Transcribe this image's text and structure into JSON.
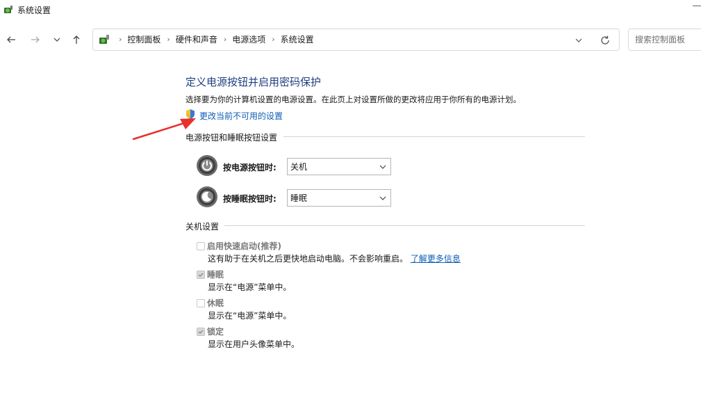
{
  "window": {
    "title": "系统设置",
    "app_icon": "power-options-icon"
  },
  "nav": {
    "back_icon": "back-arrow-icon",
    "forward_icon": "forward-arrow-icon",
    "recent_icon": "chevron-down-icon",
    "up_icon": "up-arrow-icon",
    "breadcrumbs": [
      "控制面板",
      "硬件和声音",
      "电源选项",
      "系统设置"
    ],
    "search_placeholder": "搜索控制面板"
  },
  "main": {
    "title": "定义电源按钮并启用密码保护",
    "description": "选择要为你的计算机设置的电源设置。在此页上对设置所做的更改将应用于你所有的电源计划。",
    "change_link": "更改当前不可用的设置",
    "power_section": {
      "label": "电源按钮和睡眠按钮设置",
      "rows": [
        {
          "label": "按电源按钮时:",
          "value": "关机"
        },
        {
          "label": "按睡眠按钮时:",
          "value": "睡眠"
        }
      ]
    },
    "shutdown_section": {
      "label": "关机设置",
      "options": [
        {
          "label": "启用快速启动(推荐)",
          "checked": false,
          "desc": "这有助于在关机之后更快地启动电脑。不会影响重启。",
          "link": "了解更多信息"
        },
        {
          "label": "睡眠",
          "checked": true,
          "desc": "显示在“电源”菜单中。"
        },
        {
          "label": "休眠",
          "checked": false,
          "desc": "显示在“电源”菜单中。"
        },
        {
          "label": "锁定",
          "checked": true,
          "desc": "显示在用户头像菜单中。"
        }
      ]
    }
  },
  "colors": {
    "title": "#1e3f80",
    "link": "#0e5cb6",
    "annotation_arrow": "#e8302c"
  }
}
